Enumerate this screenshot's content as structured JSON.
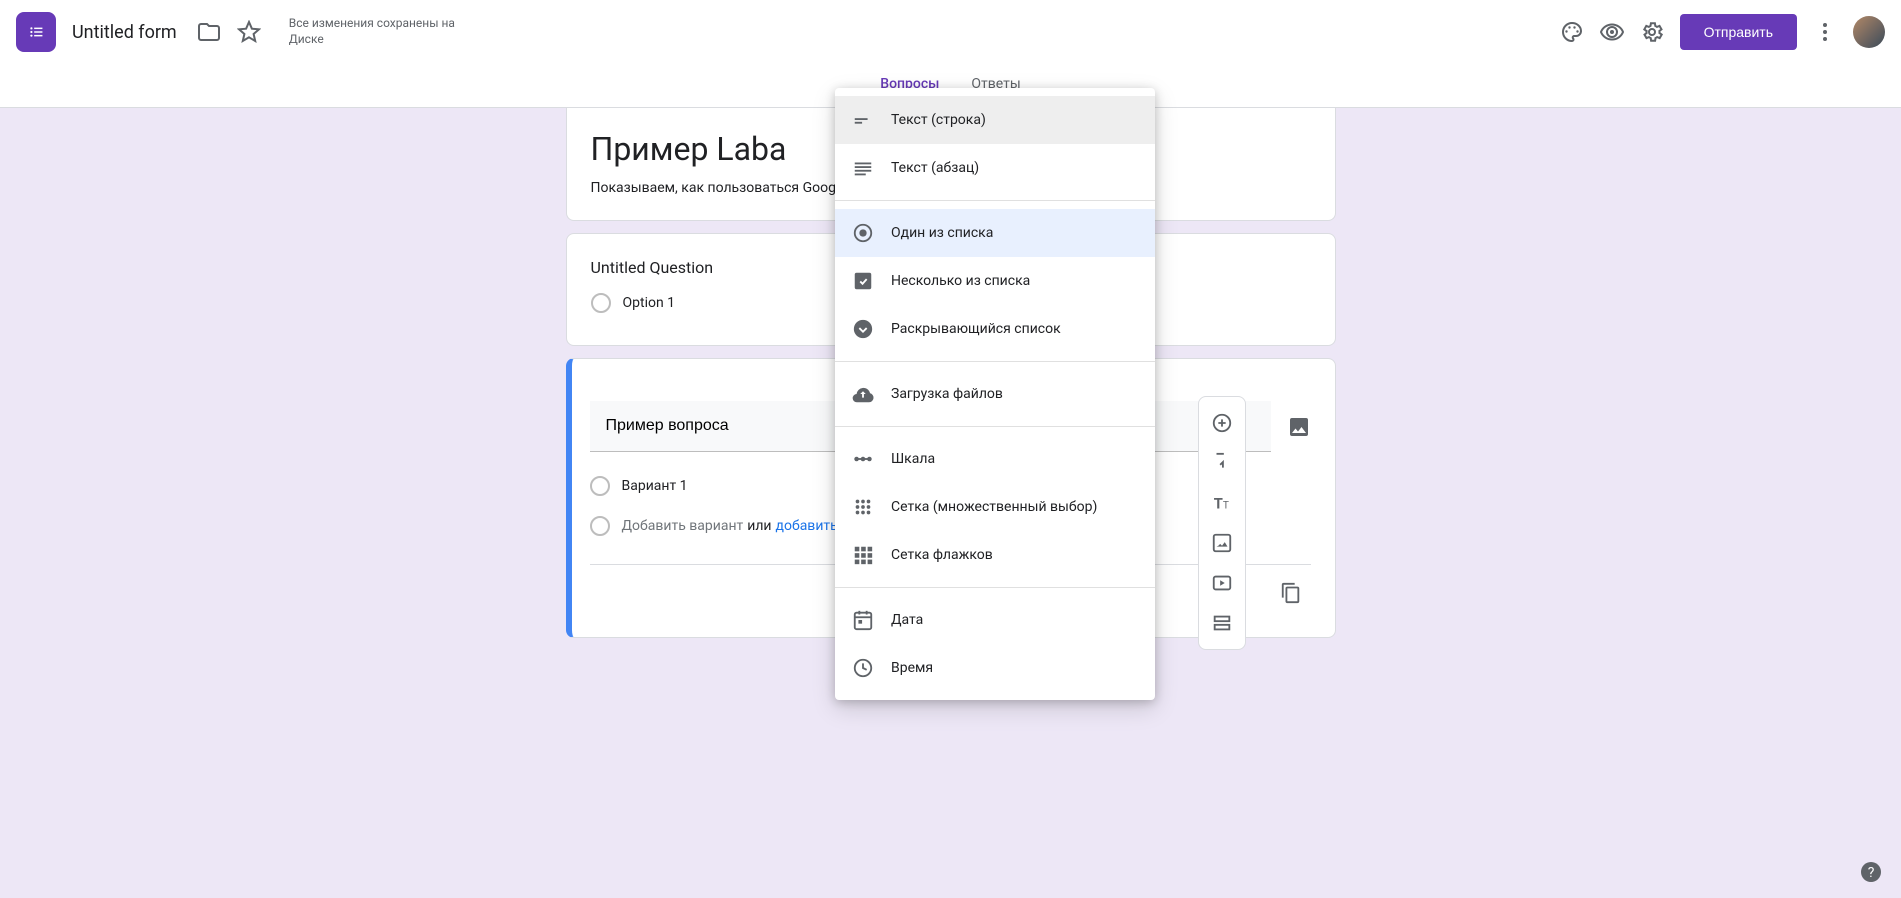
{
  "header": {
    "doc_title": "Untitled form",
    "save_status": "Все изменения сохранены на Диске",
    "send_label": "Отправить"
  },
  "tabs": {
    "questions": "Вопросы",
    "responses": "Ответы"
  },
  "form": {
    "title": "Пример Laba",
    "description": "Показываем, как пользоваться Google Формами."
  },
  "question1": {
    "title": "Untitled Question",
    "option1": "Option 1"
  },
  "question2": {
    "title": "Пример вопроса",
    "option1": "Вариант 1",
    "add_option": "Добавить вариант",
    "or": "или",
    "add_other": "добавить вариант \"Другое\""
  },
  "question_types": {
    "short_text": "Текст (строка)",
    "paragraph": "Текст (абзац)",
    "multiple_choice": "Один из списка",
    "checkboxes": "Несколько из списка",
    "dropdown": "Раскрывающийся список",
    "file_upload": "Загрузка файлов",
    "linear_scale": "Шкала",
    "mc_grid": "Сетка (множественный выбор)",
    "checkbox_grid": "Сетка флажков",
    "date": "Дата",
    "time": "Время"
  },
  "colors": {
    "primary": "#673ab7",
    "accent_blue": "#4285f4",
    "link": "#1a73e8",
    "canvas_bg": "#ede7f6"
  }
}
